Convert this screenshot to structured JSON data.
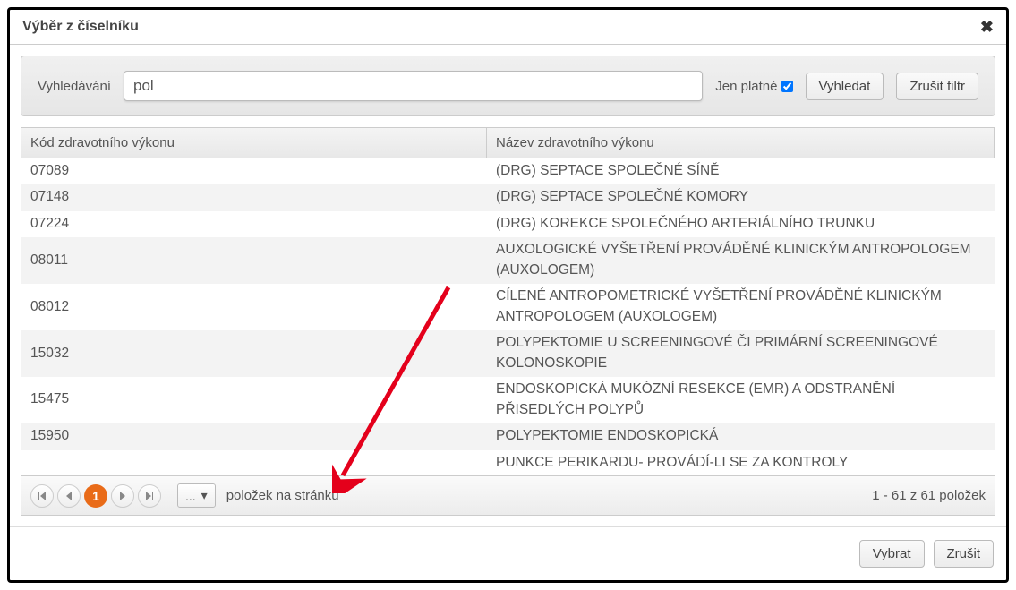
{
  "dialog": {
    "title": "Výběr z číselníku",
    "close_symbol": "✖"
  },
  "filter": {
    "search_label": "Vyhledávání",
    "search_value": "pol",
    "valid_only_label": "Jen platné",
    "valid_only_checked": true,
    "search_button": "Vyhledat",
    "clear_button": "Zrušit filtr"
  },
  "grid": {
    "columns": {
      "code": "Kód zdravotního výkonu",
      "name": "Název zdravotního výkonu"
    },
    "rows": [
      {
        "code": "07089",
        "name": "(DRG) SEPTACE SPOLEČNÉ SÍNĚ"
      },
      {
        "code": "07148",
        "name": "(DRG) SEPTACE SPOLEČNÉ KOMORY"
      },
      {
        "code": "07224",
        "name": "(DRG) KOREKCE SPOLEČNÉHO ARTERIÁLNÍHO TRUNKU"
      },
      {
        "code": "08011",
        "name": "AUXOLOGICKÉ VYŠETŘENÍ PROVÁDĚNÉ KLINICKÝM ANTROPOLOGEM (AUXOLOGEM)"
      },
      {
        "code": "08012",
        "name": "CÍLENÉ ANTROPOMETRICKÉ VYŠETŘENÍ PROVÁDĚNÉ KLINICKÝM ANTROPOLOGEM (AUXOLOGEM)"
      },
      {
        "code": "15032",
        "name": "POLYPEKTOMIE U SCREENINGOVÉ ČI PRIMÁRNÍ SCREENINGOVÉ KOLONOSKOPIE"
      },
      {
        "code": "15475",
        "name": "ENDOSKOPICKÁ MUKÓZNÍ RESEKCE (EMR) A ODSTRANĚNÍ PŘISEDLÝCH POLYPŮ"
      },
      {
        "code": "15950",
        "name": "POLYPEKTOMIE ENDOSKOPICKÁ"
      },
      {
        "code": "",
        "name": "PUNKCE PERIKARDU- PROVÁDÍ-LI SE ZA KONTROLY"
      }
    ]
  },
  "pager": {
    "current_page": "1",
    "page_size_label": "...",
    "items_label": "položek na stránku",
    "info": "1 - 61 z 61 položek"
  },
  "footer": {
    "select": "Vybrat",
    "cancel": "Zrušit"
  }
}
